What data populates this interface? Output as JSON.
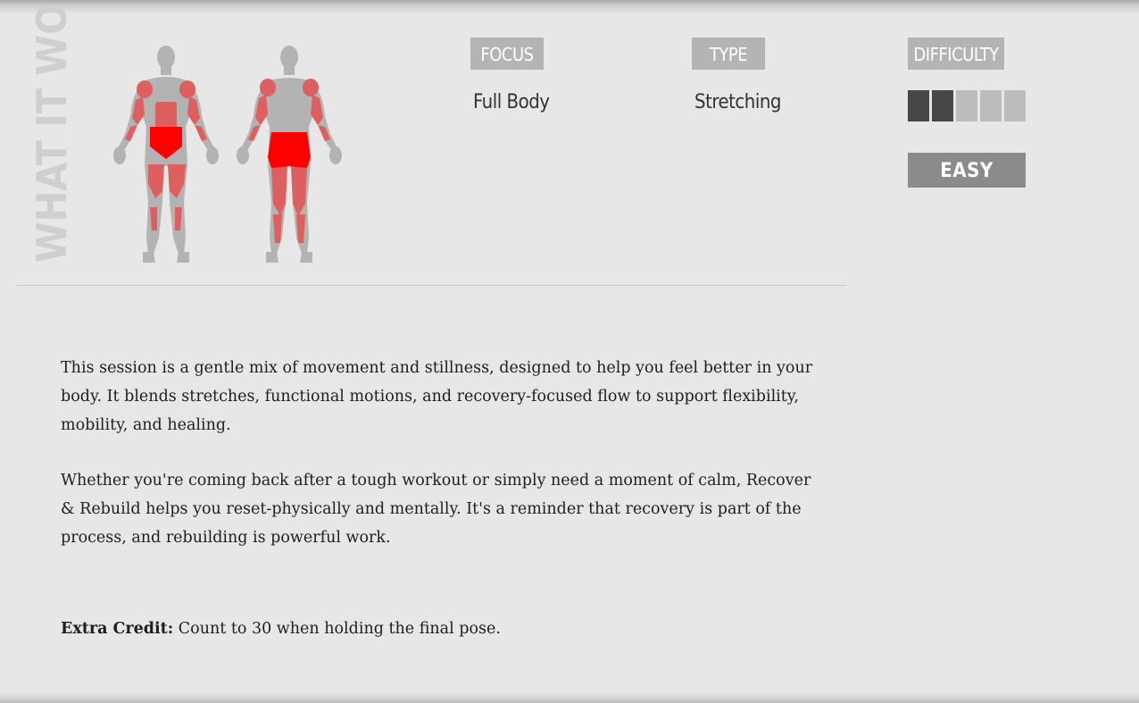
{
  "section": {
    "heading": "WHAT IT WORKS"
  },
  "meta": {
    "focus": {
      "label": "FOCUS",
      "value": "Full Body"
    },
    "type": {
      "label": "TYPE",
      "value": "Stretching"
    },
    "difficulty": {
      "label": "DIFFICULTY",
      "level": 2,
      "max": 5,
      "badge": "EASY"
    }
  },
  "description": {
    "paragraph1": "This session is a gentle mix of movement and stillness, designed to help you feel better in your body. It blends stretches, functional motions, and recovery-focused flow to support flexibility, mobility, and healing.",
    "paragraph2": "Whether you're coming back after a tough workout or simply need a moment of calm, Recover & Rebuild helps you reset-physically and mentally. It's a reminder that recovery is part of the process, and rebuilding is powerful work.",
    "extra_credit_label": "Extra Credit:",
    "extra_credit_text": " Count to 30 when holding the final pose."
  },
  "colors": {
    "background": "#e7e7e7",
    "body_base": "#b3b3b3",
    "muscle_secondary": "#de5f5f",
    "muscle_primary": "#ff0000",
    "label_bg": "#b4b4b4",
    "difficulty_on": "#474747",
    "difficulty_off": "#bcbcbc",
    "badge_bg": "#8b8b8b"
  }
}
